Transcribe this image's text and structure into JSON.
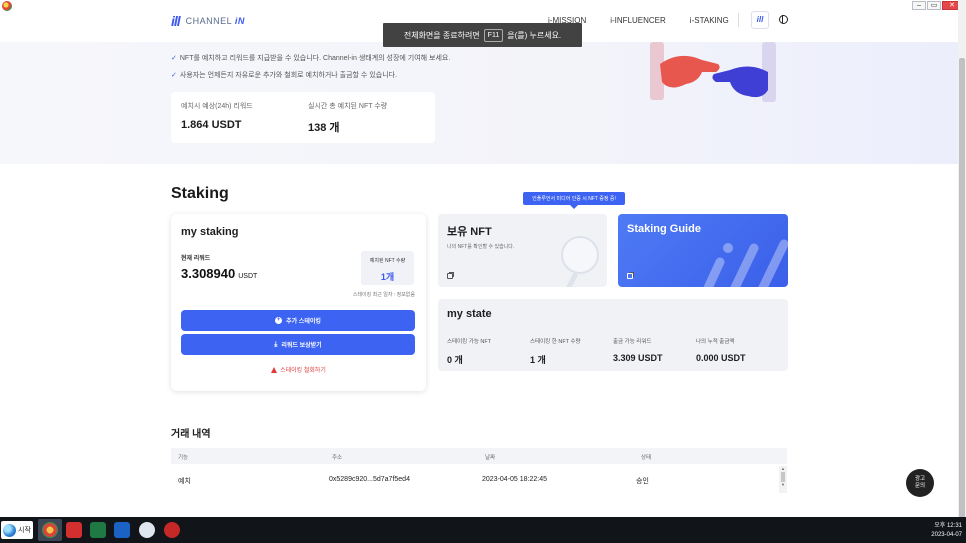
{
  "header": {
    "logo_mark": "ill",
    "logo_text": "CHANNEL",
    "logo_text_accent": "iN",
    "nav": [
      "i-MISSION",
      "i-INFLUENCER",
      "i-STAKING"
    ],
    "nav_logo": "ill"
  },
  "toast": {
    "before": "전체화면을 종료하려면",
    "key": "F11",
    "after": "을(를) 누르세요."
  },
  "hero": {
    "bullets": [
      "NFT를 예치하고 리워드를 지급받을 수 있습니다. Channel-in 생태계의 성장에 기여해 보세요.",
      "사용자는 언제든지 자유로운 추가와 철회로 예치하거나 출금할 수 있습니다."
    ],
    "expected_reward_label": "예치시 예상(24h) 리워드",
    "expected_reward_value": "1.864 USDT",
    "staked_nft_label": "실시간 총 예치된 NFT 수량",
    "staked_nft_value": "138 개"
  },
  "section_title": "Staking",
  "my_staking": {
    "title": "my staking",
    "current_reward_label": "현재 리워드",
    "current_reward_value": "3.308940",
    "current_reward_unit": "USDT",
    "nft_count_label": "예치된 NFT 수량",
    "nft_count_value": "1개",
    "last_date": "스테이킹 최근 일자 : 정보없음",
    "stake_button": "추가 스테이킹",
    "reward_button": "리워드 보상받기",
    "cancel_link": "스테이킹 철회하기"
  },
  "tooltip": "인플루언서 미디어 인증 시 NFT 증정 중!",
  "owned_nft": {
    "title": "보유 NFT",
    "subtitle": "나의 NFT를 확인할 수 있습니다."
  },
  "guide": {
    "title": "Staking Guide"
  },
  "my_state": {
    "title": "my state",
    "items": [
      {
        "label": "스테이킹 가능 NFT",
        "value": "0 개"
      },
      {
        "label": "스테이킹 한 NFT 수량",
        "value": "1 개"
      },
      {
        "label": "출금 가능 리워드",
        "value": "3.309 USDT"
      },
      {
        "label": "나의 누적 출금액",
        "value": "0.000 USDT"
      }
    ]
  },
  "transactions": {
    "title": "거래 내역",
    "headers": [
      "기능",
      "주소",
      "날짜",
      "상태"
    ],
    "rows": [
      {
        "type": "예치",
        "address": "0x5289c920...5d7a7f5ed4",
        "date": "2023-04-05 18:22:45",
        "status": "승인"
      }
    ]
  },
  "float_button": [
    "광고",
    "문의"
  ],
  "taskbar": {
    "start_label": "시작",
    "time": "오후 12:31",
    "date": "2023-04-07"
  },
  "colors": {
    "accent": "#3d63f2",
    "danger": "#e03a3a",
    "card_bg": "#f0f2f6"
  }
}
